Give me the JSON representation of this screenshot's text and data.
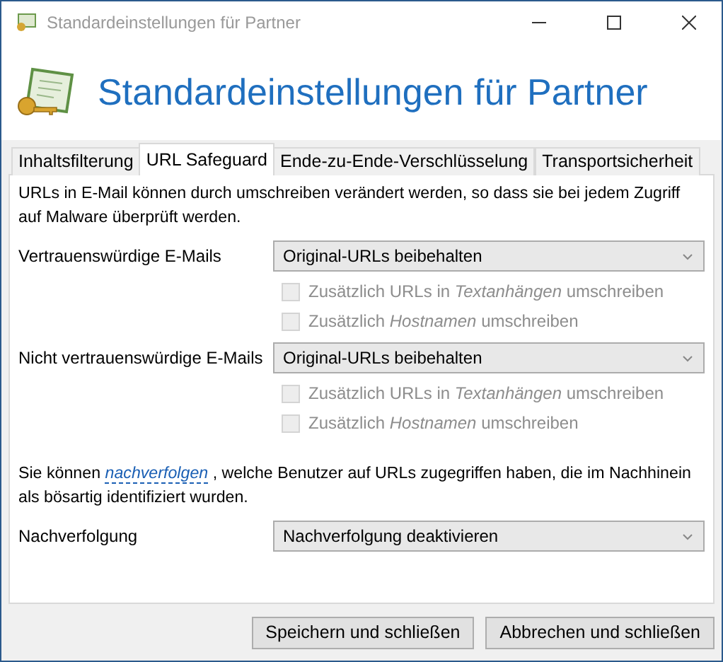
{
  "window": {
    "title": "Standardeinstellungen für Partner"
  },
  "header": {
    "title": "Standardeinstellungen für Partner"
  },
  "tabs": [
    {
      "label": "Inhaltsfilterung",
      "selected": false
    },
    {
      "label": "URL Safeguard",
      "selected": true
    },
    {
      "label": "Ende-zu-Ende-Verschlüsselung",
      "selected": false
    },
    {
      "label": "Transportsicherheit",
      "selected": false
    }
  ],
  "description": "URLs in E-Mail können durch umschreiben verändert werden, so dass sie bei jedem Zugriff auf Malware überprüft werden.",
  "groups": [
    {
      "label": "Vertrauenswürdige E-Mails",
      "value": "Original-URLs beibehalten",
      "options": [
        {
          "label": "Zusätzlich URLs in *Textanhängen* umschreiben",
          "checked": false,
          "disabled": true
        },
        {
          "label": "Zusätzlich *Hostnamen* umschreiben",
          "checked": false,
          "disabled": true
        }
      ]
    },
    {
      "label": "Nicht vertrauenswürdige E-Mails",
      "value": "Original-URLs beibehalten",
      "options": [
        {
          "label": "Zusätzlich URLs in *Textanhängen* umschreiben",
          "checked": false,
          "disabled": true
        },
        {
          "label": "Zusätzlich *Hostnamen* umschreiben",
          "checked": false,
          "disabled": true
        }
      ]
    }
  ],
  "tracking_note": {
    "before": "Sie können",
    "link": "nachverfolgen",
    "after": ", welche Benutzer auf URLs zugegriffen haben, die im Nachhinein als bösartig identifiziert wurden."
  },
  "tracking": {
    "label": "Nachverfolgung",
    "value": "Nachverfolgung deaktivieren"
  },
  "buttons": [
    "Speichern und schließen",
    "Abbrechen und schließen"
  ]
}
